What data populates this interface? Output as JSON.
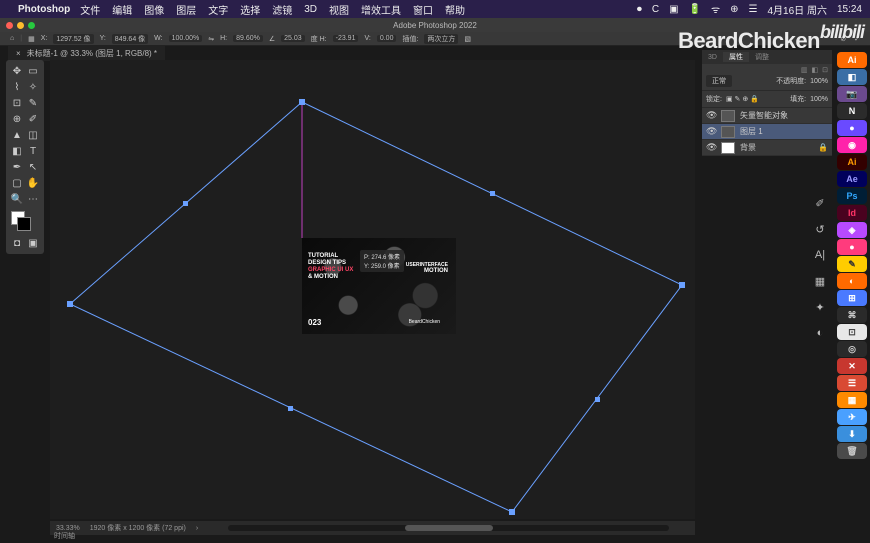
{
  "menubar": {
    "app": "Photoshop",
    "items": [
      "文件",
      "编辑",
      "图像",
      "图层",
      "文字",
      "选择",
      "滤镜",
      "3D",
      "视图",
      "增效工具",
      "窗口",
      "帮助"
    ],
    "right": {
      "date": "4月16日 周六",
      "time": "15:24"
    }
  },
  "window": {
    "title": "Adobe Photoshop 2022"
  },
  "tab": {
    "name": "未标题-1 @ 33.3% (图层 1, RGB/8) *"
  },
  "options": {
    "x": "1297.52 像",
    "y": "849.64 像",
    "w": "100.00%",
    "h": "89.60%",
    "angle": "25.03",
    "hskew": "-23.91",
    "vskew": "0.00",
    "interp": "插值:",
    "mode": "两次立方"
  },
  "embedded": {
    "tooltip": "P: 274.6 像素\nY: 259.0 像素",
    "t1": "TUTORIAL",
    "t2": "DESIGN TIPS",
    "t3": "GRAPHIC UI UX",
    "t4": "& MOTION",
    "t5": "USERINTERFACE",
    "t6": "MOTION",
    "t7": "023",
    "t8": "BeardChicken"
  },
  "panels": {
    "tabs": {
      "t3d": "3D",
      "prop": "属性",
      "adjust": "调整"
    },
    "blend": "正常",
    "opacity_lbl": "不透明度:",
    "opacity": "100%",
    "lock_lbl": "锁定:",
    "fill_lbl": "填充:",
    "fill_val": "100%",
    "layer0": "矢量智能对象",
    "layer1": "图层 1",
    "layer2": "背景"
  },
  "status": {
    "zoom": "33.33%",
    "dims": "1920 像素 x 1200 像素 (72 ppi)",
    "timeline": "时间轴"
  },
  "watermark": "BeardChicken",
  "watermark2": "bilibili",
  "dock": [
    {
      "bg": "#ff6a00",
      "t": "Ai",
      "c": "#fff"
    },
    {
      "bg": "#3a6ea5",
      "t": "◧",
      "c": "#fff"
    },
    {
      "bg": "#6b4a8e",
      "t": "📷",
      "c": "#fff"
    },
    {
      "bg": "#2b2b2b",
      "t": "N",
      "c": "#fff"
    },
    {
      "bg": "#6a4aff",
      "t": "●",
      "c": "#fff"
    },
    {
      "bg": "#ff22aa",
      "t": "◉",
      "c": "#fff"
    },
    {
      "bg": "#330000",
      "t": "Ai",
      "c": "#ff9a00"
    },
    {
      "bg": "#00005b",
      "t": "Ae",
      "c": "#9999ff"
    },
    {
      "bg": "#001e36",
      "t": "Ps",
      "c": "#31a8ff"
    },
    {
      "bg": "#49021f",
      "t": "Id",
      "c": "#ff3366"
    },
    {
      "bg": "#b84aff",
      "t": "◈",
      "c": "#fff"
    },
    {
      "bg": "#ff3b7d",
      "t": "●",
      "c": "#fff"
    },
    {
      "bg": "#ffcc00",
      "t": "✎",
      "c": "#333"
    },
    {
      "bg": "#ff6a00",
      "t": "◐",
      "c": "#fff"
    },
    {
      "bg": "#4a7aff",
      "t": "⊞",
      "c": "#fff"
    },
    {
      "bg": "#2a2a2a",
      "t": "⌘",
      "c": "#ccc"
    },
    {
      "bg": "#e8e8e8",
      "t": "⊡",
      "c": "#444"
    },
    {
      "bg": "#2a2a2a",
      "t": "◎",
      "c": "#ccc"
    },
    {
      "bg": "#c7372f",
      "t": "✕",
      "c": "#fff"
    },
    {
      "bg": "#d94a33",
      "t": "☰",
      "c": "#fff"
    },
    {
      "bg": "#ff8a00",
      "t": "▦",
      "c": "#fff"
    },
    {
      "bg": "#4aa0ff",
      "t": "✈",
      "c": "#fff"
    },
    {
      "bg": "#3a8fdd",
      "t": "⬇",
      "c": "#fff"
    },
    {
      "bg": "#4a4a4a",
      "t": "🗑",
      "c": "#ccc"
    }
  ]
}
